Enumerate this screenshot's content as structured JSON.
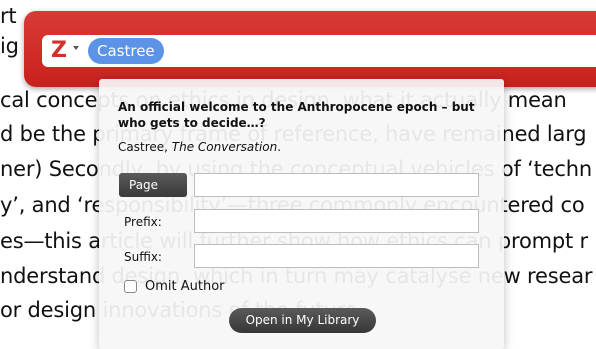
{
  "document": {
    "lines": [
      "rt",
      "ig",
      "cal concepts on ethics in design, what it actually mean",
      "d be the primary frame of reference, have remained larg",
      "ner) Secondly, by using the conceptual vehicles of ‘techn",
      "y’, and ‘responsibility’—three commonly encountered co",
      "es—this article will further show how ethics can prompt r",
      "nderstand design, which in turn may catalyse new resear",
      "or design innovations of the future."
    ]
  },
  "quickformat": {
    "logo_glyph": "Z",
    "accent_color": "#d4302b",
    "selected_item": "Castree"
  },
  "popup": {
    "title": "An official welcome to the Anthropocene epoch – but who gets to decide…?",
    "author": "Castree, ",
    "publication": "The Conversation",
    "publication_suffix": ".",
    "locator_label": "Page",
    "locator_value": "",
    "prefix_label": "Prefix:",
    "prefix_value": "",
    "suffix_label": "Suffix:",
    "suffix_value": "",
    "omit_author_label": "Omit Author",
    "omit_author_checked": false,
    "open_button_label": "Open in My Library"
  }
}
